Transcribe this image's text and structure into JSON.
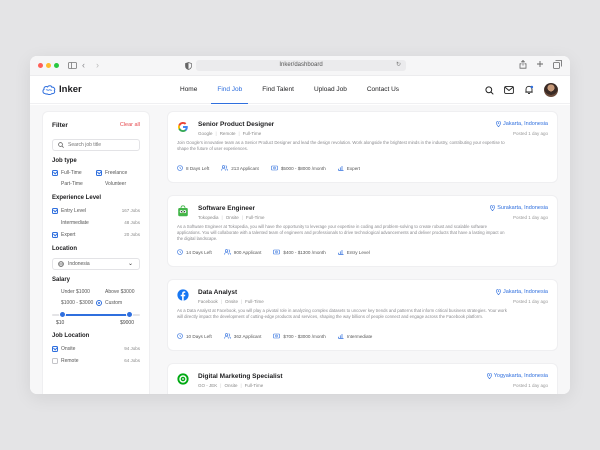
{
  "browser": {
    "url": "Inker/dashboard"
  },
  "header": {
    "logo_text": "Inker",
    "nav": [
      {
        "label": "Home"
      },
      {
        "label": "Find Job"
      },
      {
        "label": "Find Talent"
      },
      {
        "label": "Upload Job"
      },
      {
        "label": "Contact Us"
      }
    ],
    "active_nav": "Find Job"
  },
  "sidebar": {
    "filter_title": "Filter",
    "clear_all": "Clear all",
    "search_placeholder": "Search job title",
    "job_type": {
      "title": "Job type",
      "options": [
        {
          "label": "Full-Time",
          "checked": true
        },
        {
          "label": "Freelance",
          "checked": true
        },
        {
          "label": "Part-Time",
          "checked": false
        },
        {
          "label": "Volunteer",
          "checked": false
        }
      ]
    },
    "experience": {
      "title": "Experience Level",
      "options": [
        {
          "label": "Entry Level",
          "count": "167 Jobs",
          "checked": true
        },
        {
          "label": "Intermediate",
          "count": "48 Jobs",
          "checked": false
        },
        {
          "label": "Expert",
          "count": "20 Jobs",
          "checked": true
        }
      ]
    },
    "location": {
      "title": "Location",
      "value": "Indonesia"
    },
    "salary": {
      "title": "Salary",
      "options": [
        {
          "label": "Under $1000",
          "selected": false
        },
        {
          "label": "Above $3000",
          "selected": false
        },
        {
          "label": "$1000 - $3000",
          "selected": false
        },
        {
          "label": "Custom",
          "selected": true
        }
      ],
      "range_min_label": "$10",
      "range_max_label": "$9000",
      "range_low_fraction": 0.12,
      "range_high_fraction": 0.88
    },
    "job_location": {
      "title": "Job Location",
      "options": [
        {
          "label": "Onsite",
          "count": "94 Jobs",
          "checked": true
        },
        {
          "label": "Remote",
          "count": "64 Jobs",
          "checked": false
        }
      ]
    }
  },
  "jobs": [
    {
      "title": "Senior Product Designer",
      "company": "Google",
      "mode": "Remote",
      "type": "Full-Time",
      "location": "Jakarta, Indonesia",
      "posted": "Posted 1 day ago",
      "logo": "google-icon",
      "description": "Join Google's innovative team as a Senior Product Designer and lead the design revolution. Work alongside the brightest minds in the industry, contributing your expertise to shape the future of user experiences.",
      "tags": {
        "days_left": "8 Days Left",
        "applicants": "213 Applicant",
        "salary": "$5000 - $8000 /month",
        "level": "Expert"
      }
    },
    {
      "title": "Software Engineer",
      "company": "Tokopedia",
      "mode": "Onsite",
      "type": "Full-Time",
      "location": "Surakarta, Indonesia",
      "posted": "Posted 1 day ago",
      "logo": "tokopedia-icon",
      "description": "As a Software Engineer at Tokopedia, you will have the opportunity to leverage your expertise in coding and problem-solving to create robust and scalable software applications. You will collaborate with a talented team of engineers and professionals to drive technological advancements and deliver products that have a lasting impact on the digital landscape.",
      "tags": {
        "days_left": "14 Days Left",
        "applicants": "900 Applicant",
        "salary": "$400 - $1300 /month",
        "level": "Entry Level"
      }
    },
    {
      "title": "Data Analyst",
      "company": "Facebook",
      "mode": "Onsite",
      "type": "Full-Time",
      "location": "Jakarta, Indonesia",
      "posted": "Posted 1 day ago",
      "logo": "facebook-icon",
      "description": "As a Data Analyst at Facebook, you will play a pivotal role in analyzing complex datasets to uncover key trends and patterns that inform critical business strategies. Your work will directly impact the development of cutting-edge products and services, shaping the way billions of people connect and engage across the Facebook platform.",
      "tags": {
        "days_left": "10 Days Left",
        "applicants": "362 Applicant",
        "salary": "$700 - $3000 /month",
        "level": "Intermediate"
      }
    },
    {
      "title": "Digital Marketing Specialist",
      "company": "GO - JEK",
      "mode": "Onsite",
      "type": "Full-Time",
      "location": "Yogyakarta, Indonesia",
      "posted": "Posted 1 day ago",
      "logo": "gojek-icon",
      "description": "",
      "tags": {
        "days_left": "",
        "applicants": "",
        "salary": "",
        "level": ""
      }
    }
  ],
  "colors": {
    "accent": "#2f6fde",
    "clear_all": "#e5484d"
  }
}
